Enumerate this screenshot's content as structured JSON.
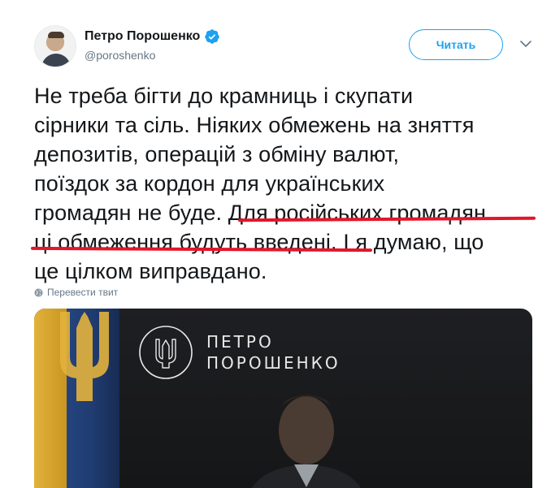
{
  "author": {
    "display_name": "Петро Порошенко",
    "handle": "@poroshenko",
    "verified": true
  },
  "actions": {
    "follow_label": "Читать"
  },
  "tweet": {
    "lines": [
      "Не треба бігти до крамниць і скупати",
      "сірники та сіль. Ніяких обмежень на зняття",
      "депозитів, операцій з обміну валют,",
      "поїздок за кордон для українських"
    ],
    "line5_a": "громадян не буде. ",
    "line5_b": "Для російських громадян",
    "line6_a": "ці обмеження будуть введені",
    "line6_b": ". І я думаю, що",
    "line7": "це цілком виправдано."
  },
  "translate": {
    "label": "Перевести твит"
  },
  "media": {
    "brand_line1": "ПЕТРО",
    "brand_line2": "ПОРОШЕНКО"
  },
  "colors": {
    "accent": "#1da1f2",
    "underline": "#e3162a",
    "text": "#14171a",
    "secondary": "#657786"
  },
  "icons": [
    "verified-icon",
    "chevron-down-icon",
    "globe-icon",
    "trident-icon"
  ]
}
